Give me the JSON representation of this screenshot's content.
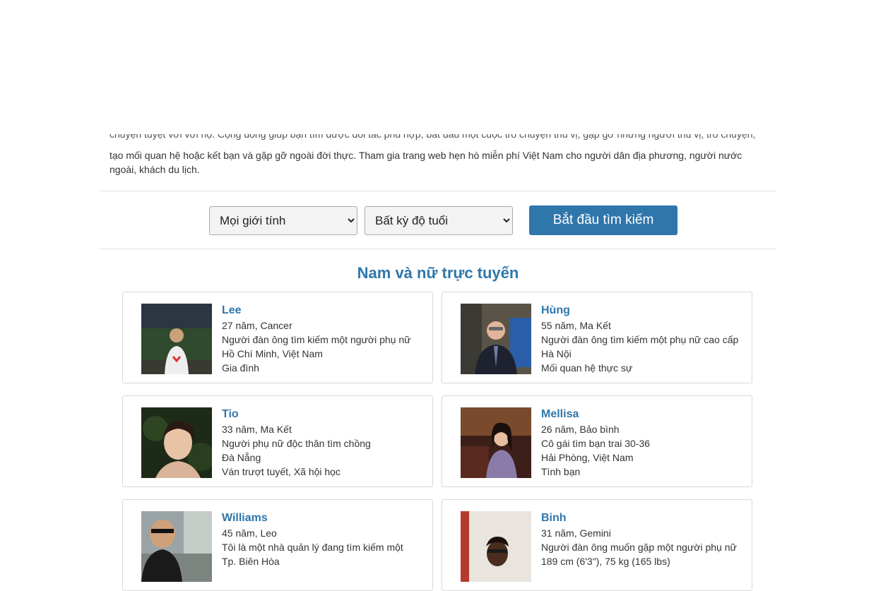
{
  "intro": {
    "line_top_clipped": "chuyện tuyệt vời với họ. Cộng đồng giúp bạn tìm được đối tác phù hợp, bắt đầu một cuộc trò chuyện thú vị, gặp gỡ những người thú vị, trò chuyện,",
    "text": "tạo mối quan hệ hoặc kết bạn và gặp gỡ ngoài đời thực. Tham gia trang web hẹn hò miễn phí Việt Nam cho người dân địa phương, người nước ngoài, khách du lịch."
  },
  "search": {
    "gender_selected": "Mọi giới tính",
    "age_selected": "Bất kỳ độ tuổi",
    "submit_label": "Bắt đầu tìm kiếm"
  },
  "online": {
    "heading": "Nam và nữ trực tuyến",
    "profiles": [
      {
        "name": "Lee",
        "age_sign": "27 năm, Cancer",
        "seeking": "Người đàn ông tìm kiếm một người phụ nữ",
        "location": "Hồ Chí Minh, Việt Nam",
        "interest": "Gia đình"
      },
      {
        "name": "Hùng",
        "age_sign": "55 năm, Ma Kết",
        "seeking": "Người đàn ông tìm kiếm một phụ nữ cao cấp",
        "location": "Hà Nội",
        "interest": "Mối quan hệ thực sự"
      },
      {
        "name": "Tio",
        "age_sign": "33 năm, Ma Kết",
        "seeking": "Người phụ nữ độc thân tìm chồng",
        "location": "Đà Nẵng",
        "interest": "Ván trượt tuyết, Xã hội học"
      },
      {
        "name": "Mellisa",
        "age_sign": "26 năm, Bảo bình",
        "seeking": "Cô gái tìm bạn trai 30-36",
        "location": "Hải Phòng, Việt Nam",
        "interest": "Tình bạn"
      },
      {
        "name": "Williams",
        "age_sign": "45 năm, Leo",
        "seeking": "Tôi là một nhà quản lý đang tìm kiếm một",
        "location": "Tp. Biên Hòa",
        "interest": ""
      },
      {
        "name": "Binh",
        "age_sign": "31 năm, Gemini",
        "seeking": "Người đàn ông muốn gặp một người phụ nữ",
        "location": "189 cm (6'3\"), 75 kg (165 lbs)",
        "interest": ""
      }
    ]
  },
  "colors": {
    "accent": "#2f76ab"
  }
}
